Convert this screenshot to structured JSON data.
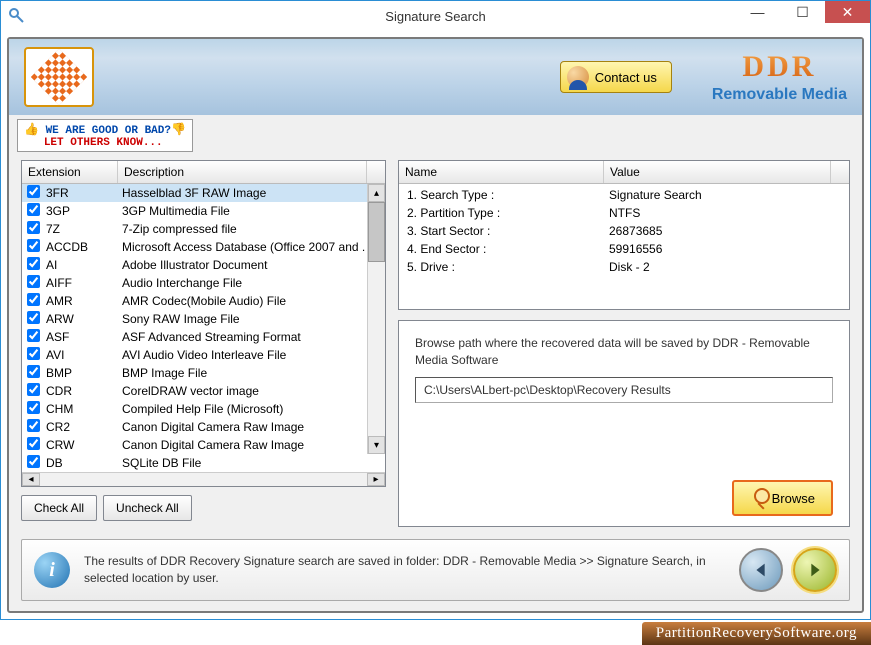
{
  "window": {
    "title": "Signature Search"
  },
  "header": {
    "contact_label": "Contact us",
    "brand_main": "DDR",
    "brand_sub": "Removable Media"
  },
  "review": {
    "line1": "WE ARE GOOD OR BAD?",
    "line2": "LET OTHERS KNOW..."
  },
  "ext_table": {
    "col_ext": "Extension",
    "col_desc": "Description",
    "rows": [
      {
        "ext": "3FR",
        "desc": "Hasselblad 3F RAW Image",
        "sel": true
      },
      {
        "ext": "3GP",
        "desc": "3GP Multimedia File"
      },
      {
        "ext": "7Z",
        "desc": "7-Zip compressed file"
      },
      {
        "ext": "ACCDB",
        "desc": "Microsoft Access Database (Office 2007 and ."
      },
      {
        "ext": "AI",
        "desc": "Adobe Illustrator Document"
      },
      {
        "ext": "AIFF",
        "desc": "Audio Interchange File"
      },
      {
        "ext": "AMR",
        "desc": "AMR Codec(Mobile Audio) File"
      },
      {
        "ext": "ARW",
        "desc": "Sony RAW Image File"
      },
      {
        "ext": "ASF",
        "desc": "ASF Advanced Streaming Format"
      },
      {
        "ext": "AVI",
        "desc": "AVI Audio Video Interleave File"
      },
      {
        "ext": "BMP",
        "desc": "BMP Image File"
      },
      {
        "ext": "CDR",
        "desc": "CorelDRAW vector image"
      },
      {
        "ext": "CHM",
        "desc": "Compiled Help File (Microsoft)"
      },
      {
        "ext": "CR2",
        "desc": "Canon Digital Camera Raw Image"
      },
      {
        "ext": "CRW",
        "desc": "Canon Digital Camera Raw Image"
      },
      {
        "ext": "DB",
        "desc": "SQLite DB File"
      }
    ]
  },
  "buttons": {
    "check_all": "Check All",
    "uncheck_all": "Uncheck All",
    "browse": "Browse"
  },
  "info_table": {
    "col_name": "Name",
    "col_value": "Value",
    "rows": [
      {
        "n": "1. Search Type :",
        "v": "Signature Search"
      },
      {
        "n": "2. Partition Type :",
        "v": "NTFS"
      },
      {
        "n": "3. Start Sector :",
        "v": "26873685"
      },
      {
        "n": "4. End Sector :",
        "v": "59916556"
      },
      {
        "n": "5. Drive :",
        "v": "Disk - 2"
      }
    ]
  },
  "browse_panel": {
    "prompt": "Browse path where the recovered data will be saved by DDR - Removable Media Software",
    "path": "C:\\Users\\ALbert-pc\\Desktop\\Recovery Results"
  },
  "footer": {
    "text": "The results of DDR Recovery Signature search are saved in folder: DDR - Removable Media  >> Signature Search, in selected location by user."
  },
  "watermark": "PartitionRecoverySoftware.org"
}
